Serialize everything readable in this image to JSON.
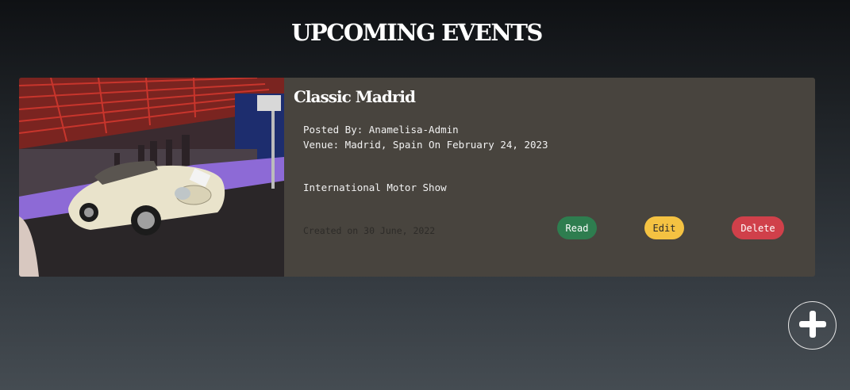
{
  "page": {
    "title": "UPCOMING EVENTS"
  },
  "events": [
    {
      "title": "Classic Madrid",
      "posted_by": "Posted By: Anamelisa-Admin",
      "venue": "Venue: Madrid, Spain On February 24, 2023",
      "description": "International Motor Show",
      "created": "Created on 30 June, 2022",
      "image": "classic-car-photo",
      "actions": {
        "read_label": "Read",
        "edit_label": "Edit",
        "delete_label": "Delete"
      }
    }
  ],
  "add_button": {
    "icon": "plus-icon"
  },
  "colors": {
    "card_background": "#48443e",
    "read": "#2e7d4f",
    "edit": "#f4c242",
    "delete": "#d0404a"
  }
}
